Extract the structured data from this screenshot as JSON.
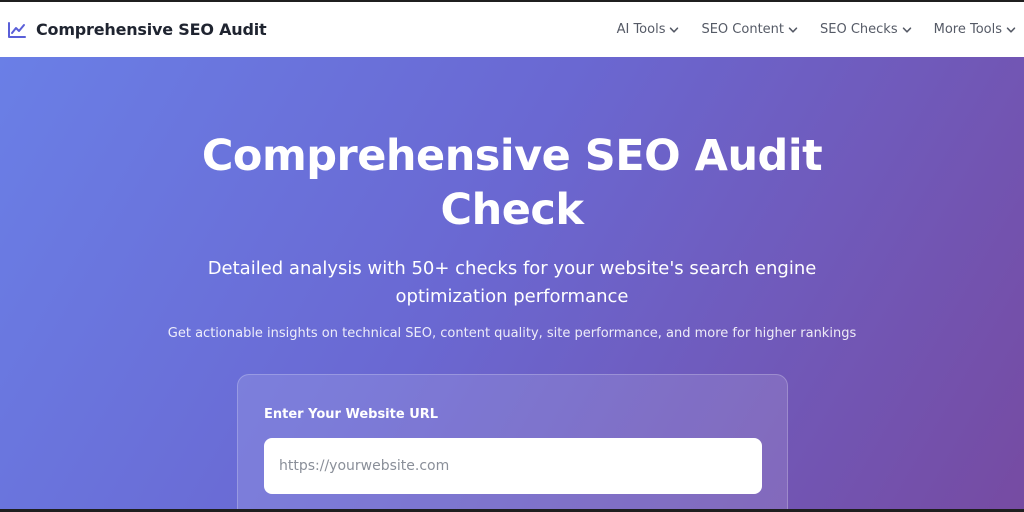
{
  "header": {
    "brand_title": "Comprehensive SEO Audit",
    "nav": [
      {
        "label": "AI Tools"
      },
      {
        "label": "SEO Content"
      },
      {
        "label": "SEO Checks"
      },
      {
        "label": "More Tools"
      }
    ]
  },
  "hero": {
    "title": "Comprehensive SEO Audit Check",
    "subtitle": "Detailed analysis with 50+ checks for your website's search engine optimization performance",
    "note": "Get actionable insights on technical SEO, content quality, site performance, and more for higher rankings"
  },
  "form": {
    "label": "Enter Your Website URL",
    "url_placeholder": "https://yourwebsite.com",
    "url_value": ""
  },
  "colors": {
    "accent": "#5a5fd8",
    "gradient_start": "#6a7fe6",
    "gradient_end": "#764ba2"
  }
}
